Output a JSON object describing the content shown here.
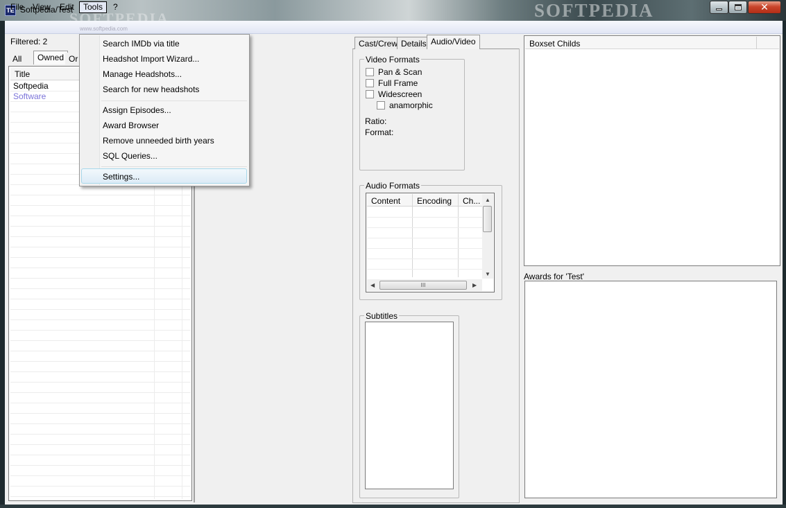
{
  "window": {
    "title": "Softpedia/Test",
    "icon_text": "TE",
    "watermark_small": "SOFTPEDIA",
    "watermark_large": "SOFTPEDIA",
    "watermark_url": "www.softpedia.com",
    "close_glyph": "✕"
  },
  "menubar": {
    "file": "File",
    "view": "View",
    "edit": "Edit",
    "tools": "Tools",
    "help": "?"
  },
  "tools_menu": {
    "items": [
      "Search IMDb via title",
      "Headshot Import Wizard...",
      "Manage Headshots...",
      "Search for new headshots",
      "Assign Episodes...",
      "Award Browser",
      "Remove unneeded birth years",
      "SQL Queries...",
      "Settings..."
    ],
    "highlighted": "Settings..."
  },
  "left_panel": {
    "filtered": "Filtered: 2",
    "tabs": [
      "All",
      "Owned",
      "Or"
    ],
    "column_title": "Title",
    "rows": [
      "Softpedia",
      "Software"
    ]
  },
  "center_tabs": [
    "Cast/Crew",
    "Details",
    "Audio/Video"
  ],
  "video_formats": {
    "title": "Video Formats",
    "options": [
      "Pan & Scan",
      "Full Frame",
      "Widescreen",
      "anamorphic"
    ],
    "ratio_label": "Ratio:",
    "format_label": "Format:"
  },
  "audio_formats": {
    "title": "Audio Formats",
    "columns": [
      "Content",
      "Encoding",
      "Ch..."
    ],
    "hscroll_grip": "III"
  },
  "subtitles": {
    "title": "Subtitles"
  },
  "right_panel": {
    "boxset_column": "Boxset Childs",
    "awards_label": "Awards for 'Test'"
  },
  "colors": {
    "accent_link": "#7b73d9",
    "menu_highlight_border": "#a8d8eb",
    "close_button": "#c9452b"
  }
}
